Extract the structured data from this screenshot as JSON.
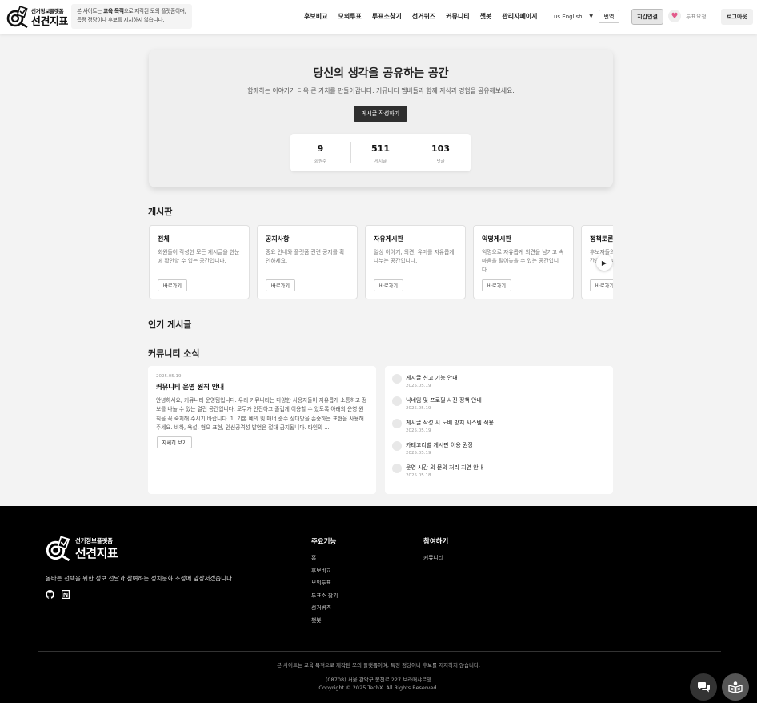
{
  "header": {
    "logo_sub": "선거정보플랫폼",
    "logo_main": "선견지표",
    "notice_prefix": "본 사이트는 ",
    "notice_bold": "교육 목적",
    "notice_suffix": "으로 제작된 모의 플랫폼이며, 특정 정당이나 후보를 지지하지 않습니다.",
    "nav": [
      "후보비교",
      "모의투표",
      "투표소찾기",
      "선거퀴즈",
      "커뮤니티",
      "챗봇",
      "관리자페이지"
    ],
    "language": "us English",
    "translate_label": "번역",
    "wallet_label": "지갑연결",
    "vote_request_label": "투표요청",
    "logout_label": "로그아웃"
  },
  "hero": {
    "title": "당신의 생각을 공유하는 공간",
    "subtitle": "함께하는 이야기가 더욱 큰 가치를 만들어갑니다. 커뮤니티 멤버들과 함께 지식과 경험을 공유해보세요.",
    "write_button": "게시글 작성하기",
    "stats": [
      {
        "value": "9",
        "label": "회원수"
      },
      {
        "value": "511",
        "label": "게시글"
      },
      {
        "value": "103",
        "label": "댓글"
      }
    ]
  },
  "boards_section": {
    "title": "게시판",
    "go_label": "바로가기",
    "items": [
      {
        "name": "전체",
        "desc": "회원들이 작성한 모든 게시글을 한눈에 확인할 수 있는 공간입니다."
      },
      {
        "name": "공지사항",
        "desc": "중요 안내와 플랫폼 관련 공지를 확인하세요."
      },
      {
        "name": "자유게시판",
        "desc": "일상 이야기, 의견, 유머를 자유롭게 나누는 공간입니다."
      },
      {
        "name": "익명게시판",
        "desc": "익명으로 자유롭게 의견을 남기고 속마음을 털어놓을 수 있는 공간입니다."
      },
      {
        "name": "정책토론",
        "desc": "후보자들의 정책에 대해 토론하는 공간을 합니다."
      }
    ]
  },
  "popular_section": {
    "title": "인기 게시글"
  },
  "news_section": {
    "title": "커뮤니티 소식",
    "featured": {
      "date": "2025.05.19",
      "title": "커뮤니티 운영 원칙 안내",
      "body": "안녕하세요, 커뮤니티 운영팀입니다. 우리 커뮤니티는 다양한 사용자들이 자유롭게 소통하고 정보를 나눌 수 있는 열린 공간입니다. 모두가 안전하고 즐겁게 이용할 수 있도록 아래의 운영 원칙을 꼭 숙지해 주시기 바랍니다. 1. 기본 예의 및 매너 준수 상대방을 존중하는 표현을 사용해 주세요. 비하, 욕설, 혐오 표현, 인신공격성 발언은 절대 금지됩니다. 타인의 ...",
      "more_label": "자세히 보기"
    },
    "list": [
      {
        "title": "게시글 신고 기능 안내",
        "date": "2025.05.19"
      },
      {
        "title": "닉네임 및 프로필 사진 정책 안내",
        "date": "2025.05.19"
      },
      {
        "title": "게시글 작성 시 도배 방지 시스템 적용",
        "date": "2025.05.19"
      },
      {
        "title": "카테고리별 게시판 이용 권장",
        "date": "2025.05.19"
      },
      {
        "title": "운영 시간 외 문의 처리 지연 안내",
        "date": "2025.05.18"
      }
    ]
  },
  "footer": {
    "logo_sub": "선거정보플랫폼",
    "logo_main": "선견지표",
    "tagline": "올바른 선택을 위한 정보 전달과 참여하는 정치문화 조성에 앞장서겠습니다.",
    "col1_title": "주요기능",
    "col1_items": [
      "홈",
      "후보비교",
      "모의투표",
      "투표소 찾기",
      "선거퀴즈",
      "챗봇"
    ],
    "col2_title": "참여하기",
    "col2_items": [
      "커뮤니티"
    ],
    "disclaimer": "본 사이트는 교육 목적으로 제작된 모의 플랫폼이며, 특정 정당이나 후보를 지지하지 않습니다.",
    "address": "(08708) 서울 관악구 봉천로 227 보라매샤르망",
    "copyright": "Copyright © 2025 TechX. All Rights Reserved."
  }
}
